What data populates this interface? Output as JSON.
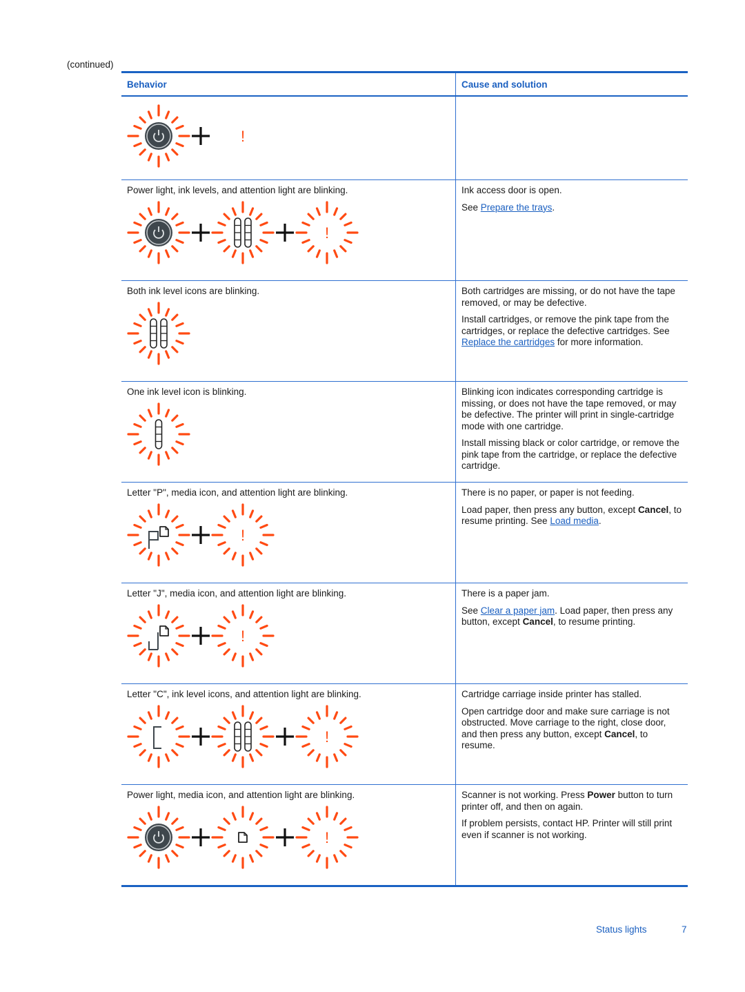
{
  "continued_label": "(continued)",
  "table": {
    "headers": {
      "behavior": "Behavior",
      "cause": "Cause and solution"
    },
    "rows": [
      {
        "behavior": "",
        "icons": [
          "power-light",
          "plus",
          "attention-light-static"
        ],
        "cause": []
      },
      {
        "behavior": "Power light, ink levels, and attention light are blinking.",
        "icons": [
          "power-light",
          "plus",
          "ink-levels-both",
          "plus",
          "attention-light"
        ],
        "cause": [
          {
            "text": "Ink access door is open."
          },
          {
            "pre": "See ",
            "link": "Prepare the trays",
            "post": "."
          }
        ]
      },
      {
        "behavior": "Both ink level icons are blinking.",
        "icons": [
          "ink-levels-both"
        ],
        "cause": [
          {
            "text": "Both cartridges are missing, or do not have the tape removed, or may be defective."
          },
          {
            "text": "Install cartridges, or remove the pink tape from the cartridges, or replace the defective cartridges.",
            "pre": "See ",
            "link": "Replace the cartridges",
            "post": " for more information."
          }
        ]
      },
      {
        "behavior": "One ink level icon is blinking.",
        "icons": [
          "ink-level-single"
        ],
        "cause": [
          {
            "text": "Blinking icon indicates corresponding cartridge is missing, or does not have the tape removed, or may be defective. The printer will print in single-cartridge mode with one cartridge."
          },
          {
            "text": "Install missing black or color cartridge, or remove the pink tape from the cartridge, or replace the defective cartridge."
          }
        ]
      },
      {
        "behavior": "Letter \"P\", media icon, and attention light are blinking.",
        "icons": [
          "letter-p-media",
          "plus",
          "attention-light"
        ],
        "cause": [
          {
            "text": "There is no paper, or paper is not feeding."
          },
          {
            "pre": "Load paper, then press any button, except ",
            "bold": "Cancel",
            "mid": ", to resume printing. See ",
            "link": "Load media",
            "post": "."
          }
        ]
      },
      {
        "behavior": "Letter \"J\", media icon, and attention light are blinking.",
        "icons": [
          "letter-j-media",
          "plus",
          "attention-light"
        ],
        "cause": [
          {
            "text": "There is a paper jam."
          },
          {
            "pre": "See ",
            "link": "Clear a paper jam",
            "mid": ". Load paper, then press any button, except ",
            "bold": "Cancel",
            "post": ", to resume printing."
          }
        ]
      },
      {
        "behavior": "Letter \"C\", ink level icons, and attention light are blinking.",
        "icons": [
          "letter-c",
          "plus",
          "ink-levels-both",
          "plus",
          "attention-light"
        ],
        "cause": [
          {
            "text": "Cartridge carriage inside printer has stalled."
          },
          {
            "pre": "Open cartridge door and make sure carriage is not obstructed. Move carriage to the right, close door, and then press any button, except ",
            "bold": "Cancel",
            "post": ", to resume."
          }
        ]
      },
      {
        "behavior": "Power light, media icon, and attention light are blinking.",
        "icons": [
          "power-light",
          "plus",
          "media",
          "plus",
          "attention-light"
        ],
        "cause": [
          {
            "pre": "Scanner is not working. Press ",
            "bold": "Power",
            "post": " button to turn printer off, and then on again."
          },
          {
            "text": "If problem persists, contact HP. Printer will still print even if scanner is not working."
          }
        ]
      }
    ]
  },
  "footer": {
    "section": "Status lights",
    "page": "7"
  },
  "colors": {
    "accent": "#1a5fc0",
    "blink": "#ff4a12",
    "icon_dark": "#3f474d"
  }
}
